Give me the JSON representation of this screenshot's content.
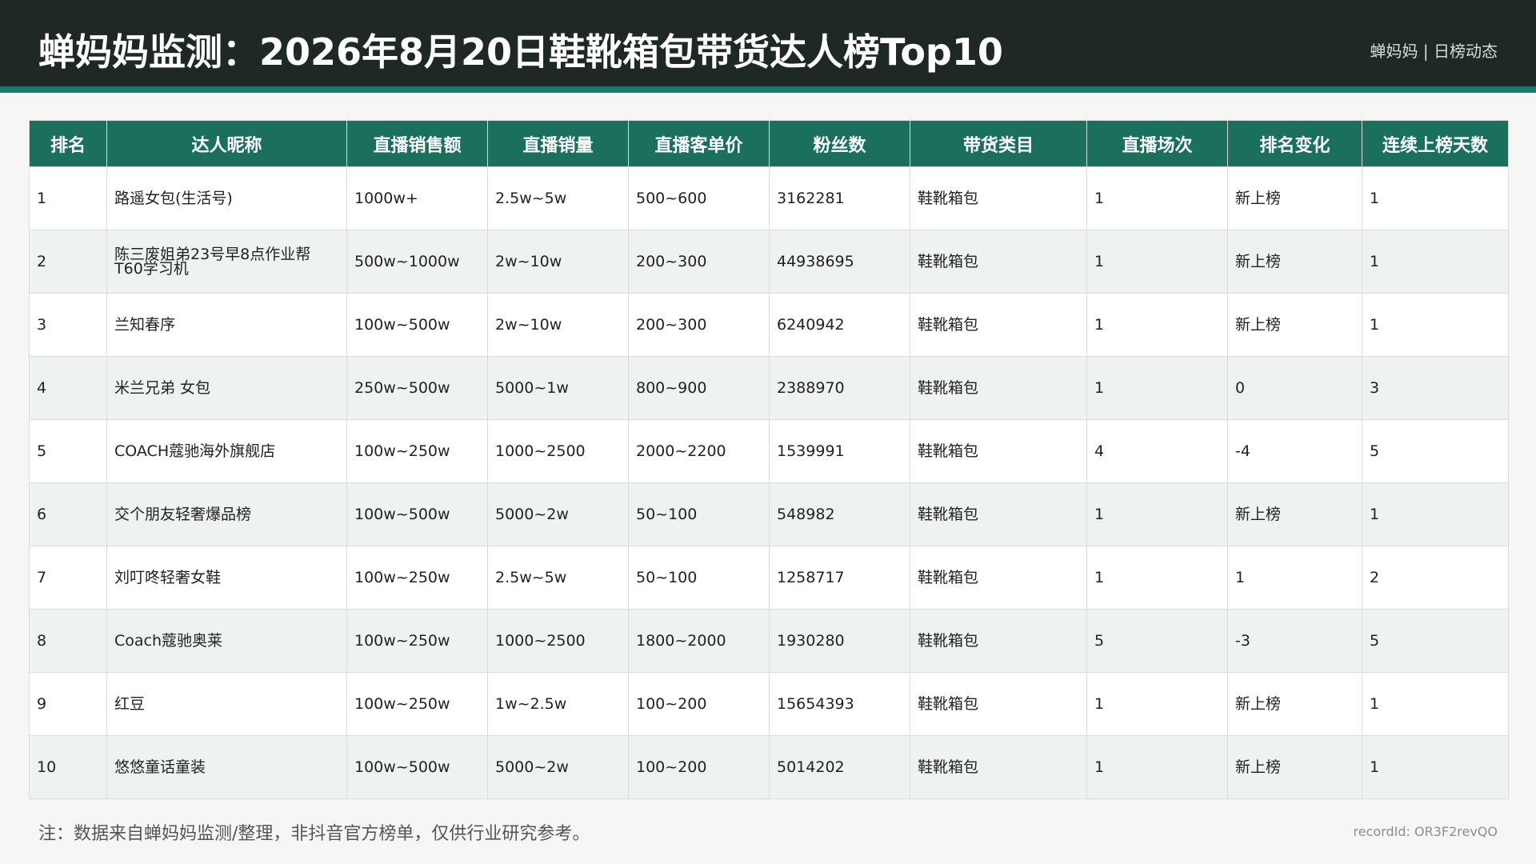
{
  "header": {
    "title": "蝉妈妈监测：2026年8月20日鞋靴箱包带货达人榜Top10",
    "brand": "蝉妈妈 | 日榜动态"
  },
  "table": {
    "columns": [
      "排名",
      "达人昵称",
      "直播销售额",
      "直播销量",
      "直播客单价",
      "粉丝数",
      "带货类目",
      "直播场次",
      "排名变化",
      "连续上榜天数"
    ],
    "rows": [
      [
        "1",
        "路遥女包(生活号)",
        "1000w+",
        "2.5w~5w",
        "500~600",
        "3162281",
        "鞋靴箱包",
        "1",
        "新上榜",
        "1"
      ],
      [
        "2",
        "陈三废姐弟23号早8点作业帮T60学习机",
        "500w~1000w",
        "2w~10w",
        "200~300",
        "44938695",
        "鞋靴箱包",
        "1",
        "新上榜",
        "1"
      ],
      [
        "3",
        "兰知春序",
        "100w~500w",
        "2w~10w",
        "200~300",
        "6240942",
        "鞋靴箱包",
        "1",
        "新上榜",
        "1"
      ],
      [
        "4",
        "米兰兄弟 女包",
        "250w~500w",
        "5000~1w",
        "800~900",
        "2388970",
        "鞋靴箱包",
        "1",
        "0",
        "3"
      ],
      [
        "5",
        "COACH蔻驰海外旗舰店",
        "100w~250w",
        "1000~2500",
        "2000~2200",
        "1539991",
        "鞋靴箱包",
        "4",
        "-4",
        "5"
      ],
      [
        "6",
        "交个朋友轻奢爆品榜",
        "100w~500w",
        "5000~2w",
        "50~100",
        "548982",
        "鞋靴箱包",
        "1",
        "新上榜",
        "1"
      ],
      [
        "7",
        "刘叮咚轻奢女鞋",
        "100w~250w",
        "2.5w~5w",
        "50~100",
        "1258717",
        "鞋靴箱包",
        "1",
        "1",
        "2"
      ],
      [
        "8",
        "Coach蔻驰奥莱",
        "100w~250w",
        "1000~2500",
        "1800~2000",
        "1930280",
        "鞋靴箱包",
        "5",
        "-3",
        "5"
      ],
      [
        "9",
        "红豆",
        "100w~250w",
        "1w~2.5w",
        "100~200",
        "15654393",
        "鞋靴箱包",
        "1",
        "新上榜",
        "1"
      ],
      [
        "10",
        "悠悠童话童装",
        "100w~500w",
        "5000~2w",
        "100~200",
        "5014202",
        "鞋靴箱包",
        "1",
        "新上榜",
        "1"
      ]
    ]
  },
  "footer": {
    "note": "注：数据来自蝉妈妈监测/整理，非抖音官方榜单，仅供行业研究参考。",
    "record_id": "recordId: OR3F2revQO"
  }
}
